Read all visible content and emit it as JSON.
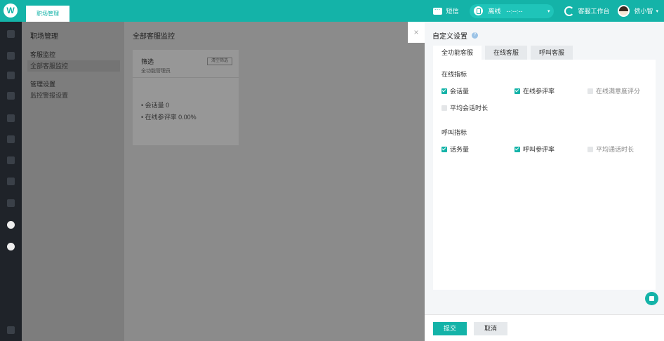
{
  "topbar": {
    "logo": "W",
    "tab_label": "职场管理",
    "sms_label": "短信",
    "status_label": "离线",
    "status_time": "--:--:--",
    "workbench_label": "客服工作台",
    "user_name": "侬小智"
  },
  "menu": {
    "title": "职场管理",
    "section1": "客服监控",
    "item1": "全部客服监控",
    "section2": "管理设置",
    "item2": "监控警报设置"
  },
  "main": {
    "title": "全部客服监控",
    "filter_title": "筛选",
    "filter_sub": "全功能管理员",
    "filter_btn": "清空筛选",
    "metrics": [
      "会话量 0",
      "在线参评率 0.00%"
    ]
  },
  "panel": {
    "close": "×",
    "title": "自定义设置",
    "help": "?",
    "tabs": [
      "全功能客服",
      "在线客服",
      "呼叫客服"
    ],
    "group1": "在线指标",
    "online_metrics": [
      {
        "label": "会话量",
        "checked": true
      },
      {
        "label": "在线参评率",
        "checked": true
      },
      {
        "label": "在线满意度评分",
        "checked": false
      },
      {
        "label": "平均会话时长",
        "checked": false
      }
    ],
    "group2": "呼叫指标",
    "call_metrics": [
      {
        "label": "话务量",
        "checked": true
      },
      {
        "label": "呼叫参评率",
        "checked": true
      },
      {
        "label": "平均通话时长",
        "checked": false
      }
    ],
    "submit": "提交",
    "cancel": "取消"
  },
  "colors": {
    "accent": "#14b3a8",
    "sidebar": "#1f2329"
  }
}
